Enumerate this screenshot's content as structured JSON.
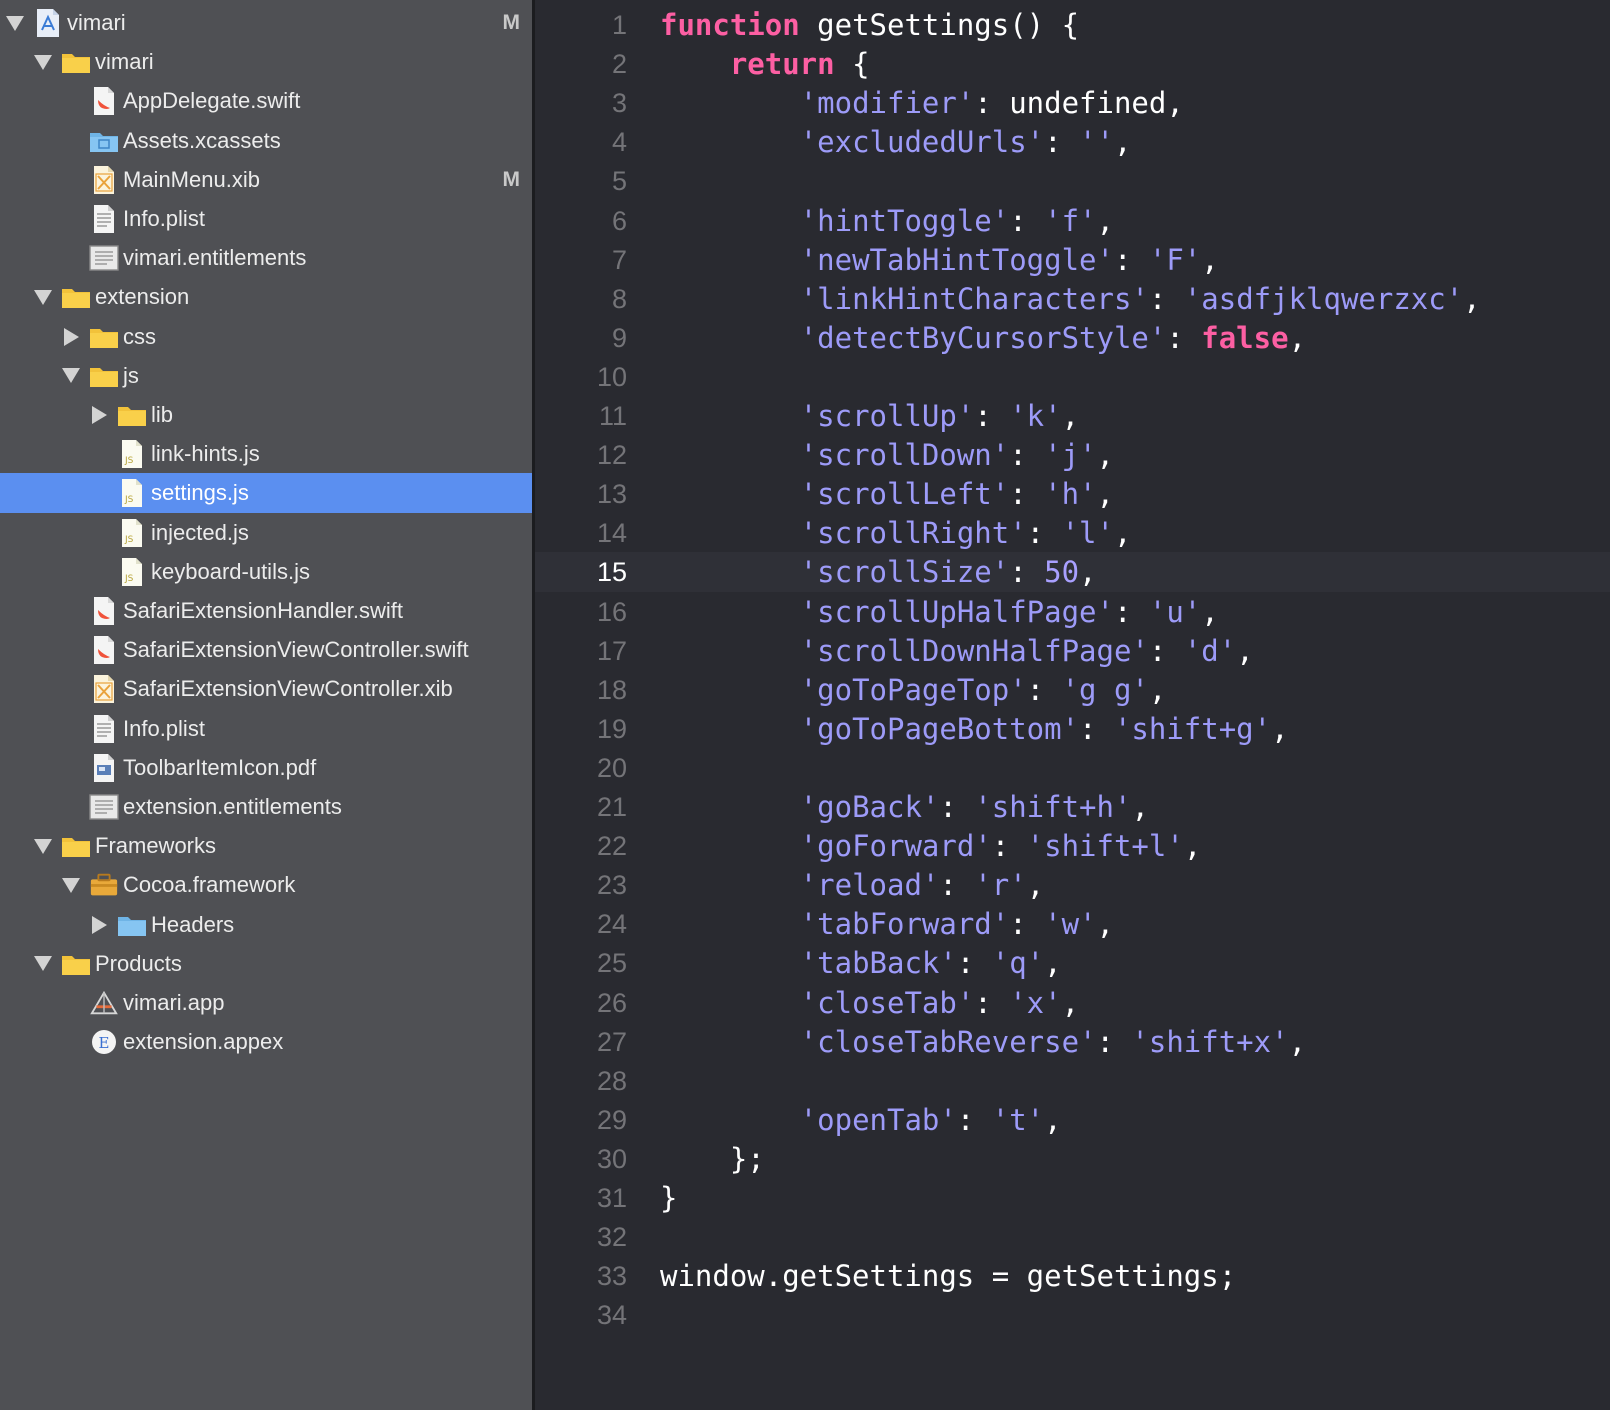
{
  "navigator": {
    "items": [
      {
        "label": "vimari",
        "badge": "M",
        "icon": "project-icon",
        "disclosure": "open",
        "level": 0
      },
      {
        "label": "vimari",
        "badge": "",
        "icon": "folder-icon",
        "disclosure": "open",
        "level": 1
      },
      {
        "label": "AppDelegate.swift",
        "badge": "",
        "icon": "swift-file-icon",
        "disclosure": "none",
        "level": 2
      },
      {
        "label": "Assets.xcassets",
        "badge": "",
        "icon": "asset-catalog-icon",
        "disclosure": "none",
        "level": 2
      },
      {
        "label": "MainMenu.xib",
        "badge": "M",
        "icon": "xib-file-icon",
        "disclosure": "none",
        "level": 2
      },
      {
        "label": "Info.plist",
        "badge": "",
        "icon": "plist-file-icon",
        "disclosure": "none",
        "level": 2
      },
      {
        "label": "vimari.entitlements",
        "badge": "",
        "icon": "entitlements-file-icon",
        "disclosure": "none",
        "level": 2
      },
      {
        "label": "extension",
        "badge": "",
        "icon": "folder-icon",
        "disclosure": "open",
        "level": 1
      },
      {
        "label": "css",
        "badge": "",
        "icon": "folder-icon",
        "disclosure": "closed",
        "level": 2
      },
      {
        "label": "js",
        "badge": "",
        "icon": "folder-icon",
        "disclosure": "open",
        "level": 2
      },
      {
        "label": "lib",
        "badge": "",
        "icon": "folder-icon",
        "disclosure": "closed",
        "level": 3
      },
      {
        "label": "link-hints.js",
        "badge": "",
        "icon": "js-file-icon",
        "disclosure": "none",
        "level": 3
      },
      {
        "label": "settings.js",
        "badge": "",
        "icon": "js-file-icon",
        "disclosure": "none",
        "level": 3,
        "selected": true
      },
      {
        "label": "injected.js",
        "badge": "",
        "icon": "js-file-icon",
        "disclosure": "none",
        "level": 3
      },
      {
        "label": "keyboard-utils.js",
        "badge": "",
        "icon": "js-file-icon",
        "disclosure": "none",
        "level": 3
      },
      {
        "label": "SafariExtensionHandler.swift",
        "badge": "",
        "icon": "swift-file-icon",
        "disclosure": "none",
        "level": 2
      },
      {
        "label": "SafariExtensionViewController.swift",
        "badge": "",
        "icon": "swift-file-icon",
        "disclosure": "none",
        "level": 2
      },
      {
        "label": "SafariExtensionViewController.xib",
        "badge": "",
        "icon": "xib-file-icon",
        "disclosure": "none",
        "level": 2
      },
      {
        "label": "Info.plist",
        "badge": "",
        "icon": "plist-file-icon",
        "disclosure": "none",
        "level": 2
      },
      {
        "label": "ToolbarItemIcon.pdf",
        "badge": "",
        "icon": "pdf-file-icon",
        "disclosure": "none",
        "level": 2
      },
      {
        "label": "extension.entitlements",
        "badge": "",
        "icon": "entitlements-file-icon",
        "disclosure": "none",
        "level": 2
      },
      {
        "label": "Frameworks",
        "badge": "",
        "icon": "folder-icon",
        "disclosure": "open",
        "level": 1
      },
      {
        "label": "Cocoa.framework",
        "badge": "",
        "icon": "framework-icon",
        "disclosure": "open",
        "level": 2
      },
      {
        "label": "Headers",
        "badge": "",
        "icon": "blue-folder-icon",
        "disclosure": "closed",
        "level": 3
      },
      {
        "label": "Products",
        "badge": "",
        "icon": "folder-icon",
        "disclosure": "open",
        "level": 1
      },
      {
        "label": "vimari.app",
        "badge": "",
        "icon": "app-icon",
        "disclosure": "none",
        "level": 2
      },
      {
        "label": "extension.appex",
        "badge": "",
        "icon": "appex-icon",
        "disclosure": "none",
        "level": 2
      }
    ]
  },
  "editor": {
    "current_line": 15,
    "lines": [
      {
        "n": "1",
        "tokens": [
          [
            "kw",
            "function"
          ],
          [
            "p",
            " getSettings() {"
          ]
        ]
      },
      {
        "n": "2",
        "tokens": [
          [
            "p",
            "    "
          ],
          [
            "kw",
            "return"
          ],
          [
            "p",
            " {"
          ]
        ]
      },
      {
        "n": "3",
        "tokens": [
          [
            "p",
            "        "
          ],
          [
            "str",
            "'modifier'"
          ],
          [
            "p",
            ": undefined,"
          ]
        ]
      },
      {
        "n": "4",
        "tokens": [
          [
            "p",
            "        "
          ],
          [
            "str",
            "'excludedUrls'"
          ],
          [
            "p",
            ": "
          ],
          [
            "str",
            "''"
          ],
          [
            "p",
            ","
          ]
        ]
      },
      {
        "n": "5",
        "tokens": []
      },
      {
        "n": "6",
        "tokens": [
          [
            "p",
            "        "
          ],
          [
            "str",
            "'hintToggle'"
          ],
          [
            "p",
            ": "
          ],
          [
            "str",
            "'f'"
          ],
          [
            "p",
            ","
          ]
        ]
      },
      {
        "n": "7",
        "tokens": [
          [
            "p",
            "        "
          ],
          [
            "str",
            "'newTabHintToggle'"
          ],
          [
            "p",
            ": "
          ],
          [
            "str",
            "'F'"
          ],
          [
            "p",
            ","
          ]
        ]
      },
      {
        "n": "8",
        "tokens": [
          [
            "p",
            "        "
          ],
          [
            "str",
            "'linkHintCharacters'"
          ],
          [
            "p",
            ": "
          ],
          [
            "str",
            "'asdfjklqwerzxc'"
          ],
          [
            "p",
            ","
          ]
        ]
      },
      {
        "n": "9",
        "tokens": [
          [
            "p",
            "        "
          ],
          [
            "str",
            "'detectByCursorStyle'"
          ],
          [
            "p",
            ": "
          ],
          [
            "kw",
            "false"
          ],
          [
            "p",
            ","
          ]
        ]
      },
      {
        "n": "10",
        "tokens": []
      },
      {
        "n": "11",
        "tokens": [
          [
            "p",
            "        "
          ],
          [
            "str",
            "'scrollUp'"
          ],
          [
            "p",
            ": "
          ],
          [
            "str",
            "'k'"
          ],
          [
            "p",
            ","
          ]
        ]
      },
      {
        "n": "12",
        "tokens": [
          [
            "p",
            "        "
          ],
          [
            "str",
            "'scrollDown'"
          ],
          [
            "p",
            ": "
          ],
          [
            "str",
            "'j'"
          ],
          [
            "p",
            ","
          ]
        ]
      },
      {
        "n": "13",
        "tokens": [
          [
            "p",
            "        "
          ],
          [
            "str",
            "'scrollLeft'"
          ],
          [
            "p",
            ": "
          ],
          [
            "str",
            "'h'"
          ],
          [
            "p",
            ","
          ]
        ]
      },
      {
        "n": "14",
        "tokens": [
          [
            "p",
            "        "
          ],
          [
            "str",
            "'scrollRight'"
          ],
          [
            "p",
            ": "
          ],
          [
            "str",
            "'l'"
          ],
          [
            "p",
            ","
          ]
        ]
      },
      {
        "n": "15",
        "tokens": [
          [
            "p",
            "        "
          ],
          [
            "str",
            "'scrollSize'"
          ],
          [
            "p",
            ": "
          ],
          [
            "num",
            "50"
          ],
          [
            "p",
            ","
          ]
        ]
      },
      {
        "n": "16",
        "tokens": [
          [
            "p",
            "        "
          ],
          [
            "str",
            "'scrollUpHalfPage'"
          ],
          [
            "p",
            ": "
          ],
          [
            "str",
            "'u'"
          ],
          [
            "p",
            ","
          ]
        ]
      },
      {
        "n": "17",
        "tokens": [
          [
            "p",
            "        "
          ],
          [
            "str",
            "'scrollDownHalfPage'"
          ],
          [
            "p",
            ": "
          ],
          [
            "str",
            "'d'"
          ],
          [
            "p",
            ","
          ]
        ]
      },
      {
        "n": "18",
        "tokens": [
          [
            "p",
            "        "
          ],
          [
            "str",
            "'goToPageTop'"
          ],
          [
            "p",
            ": "
          ],
          [
            "str",
            "'g g'"
          ],
          [
            "p",
            ","
          ]
        ]
      },
      {
        "n": "19",
        "tokens": [
          [
            "p",
            "        "
          ],
          [
            "str",
            "'goToPageBottom'"
          ],
          [
            "p",
            ": "
          ],
          [
            "str",
            "'shift+g'"
          ],
          [
            "p",
            ","
          ]
        ]
      },
      {
        "n": "20",
        "tokens": []
      },
      {
        "n": "21",
        "tokens": [
          [
            "p",
            "        "
          ],
          [
            "str",
            "'goBack'"
          ],
          [
            "p",
            ": "
          ],
          [
            "str",
            "'shift+h'"
          ],
          [
            "p",
            ","
          ]
        ]
      },
      {
        "n": "22",
        "tokens": [
          [
            "p",
            "        "
          ],
          [
            "str",
            "'goForward'"
          ],
          [
            "p",
            ": "
          ],
          [
            "str",
            "'shift+l'"
          ],
          [
            "p",
            ","
          ]
        ]
      },
      {
        "n": "23",
        "tokens": [
          [
            "p",
            "        "
          ],
          [
            "str",
            "'reload'"
          ],
          [
            "p",
            ": "
          ],
          [
            "str",
            "'r'"
          ],
          [
            "p",
            ","
          ]
        ]
      },
      {
        "n": "24",
        "tokens": [
          [
            "p",
            "        "
          ],
          [
            "str",
            "'tabForward'"
          ],
          [
            "p",
            ": "
          ],
          [
            "str",
            "'w'"
          ],
          [
            "p",
            ","
          ]
        ]
      },
      {
        "n": "25",
        "tokens": [
          [
            "p",
            "        "
          ],
          [
            "str",
            "'tabBack'"
          ],
          [
            "p",
            ": "
          ],
          [
            "str",
            "'q'"
          ],
          [
            "p",
            ","
          ]
        ]
      },
      {
        "n": "26",
        "tokens": [
          [
            "p",
            "        "
          ],
          [
            "str",
            "'closeTab'"
          ],
          [
            "p",
            ": "
          ],
          [
            "str",
            "'x'"
          ],
          [
            "p",
            ","
          ]
        ]
      },
      {
        "n": "27",
        "tokens": [
          [
            "p",
            "        "
          ],
          [
            "str",
            "'closeTabReverse'"
          ],
          [
            "p",
            ": "
          ],
          [
            "str",
            "'shift+x'"
          ],
          [
            "p",
            ","
          ]
        ]
      },
      {
        "n": "28",
        "tokens": []
      },
      {
        "n": "29",
        "tokens": [
          [
            "p",
            "        "
          ],
          [
            "str",
            "'openTab'"
          ],
          [
            "p",
            ": "
          ],
          [
            "str",
            "'t'"
          ],
          [
            "p",
            ","
          ]
        ]
      },
      {
        "n": "30",
        "tokens": [
          [
            "p",
            "    };"
          ]
        ]
      },
      {
        "n": "31",
        "tokens": [
          [
            "p",
            "}"
          ]
        ]
      },
      {
        "n": "32",
        "tokens": []
      },
      {
        "n": "33",
        "tokens": [
          [
            "p",
            "window.getSettings = getSettings;"
          ]
        ]
      },
      {
        "n": "34",
        "tokens": []
      }
    ]
  },
  "colors": {
    "navigator_bg": "#4f5054",
    "selection": "#5b8ff0",
    "editor_bg": "#292a30",
    "keyword": "#fc5fa3",
    "string": "#a9a0ff",
    "folder": "#f5c33b"
  }
}
